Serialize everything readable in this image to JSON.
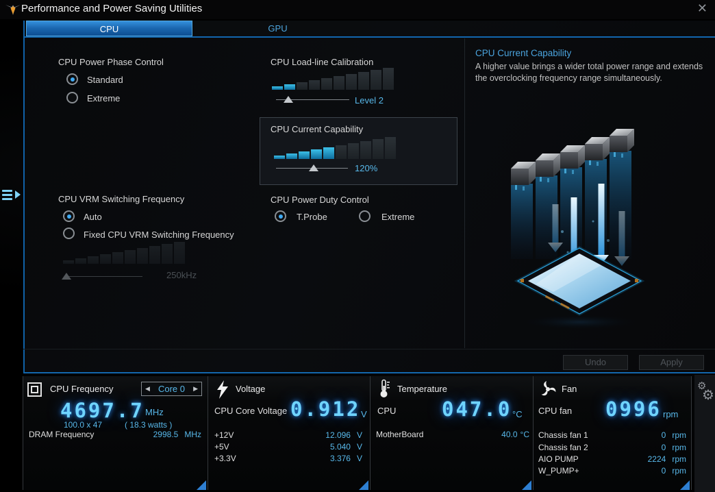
{
  "titlebar": {
    "title": "Performance and Power Saving Utilities",
    "close_icon": "✕"
  },
  "tabs": {
    "cpu": "CPU",
    "gpu": "GPU"
  },
  "controls": {
    "power_phase": {
      "label": "CPU Power Phase Control",
      "option1": "Standard",
      "option2": "Extreme",
      "selected": "Standard"
    },
    "loadline": {
      "label": "CPU Load-line Calibration",
      "value": "Level 2"
    },
    "current_capability": {
      "label": "CPU Current Capability",
      "value": "120%"
    },
    "vrm": {
      "label": "CPU VRM Switching Frequency",
      "option1": "Auto",
      "option2": "Fixed CPU VRM Switching Frequency",
      "value": "250kHz",
      "selected": "Auto"
    },
    "power_duty": {
      "label": "CPU Power Duty Control",
      "option1": "T.Probe",
      "option2": "Extreme",
      "selected": "T.Probe"
    }
  },
  "info": {
    "title": "CPU Current Capability",
    "description": "A higher value brings a wider total power range and extends the overclocking frequency range simultaneously."
  },
  "buttons": {
    "undo": "Undo",
    "apply": "Apply"
  },
  "status": {
    "cpu_freq": {
      "title": "CPU Frequency",
      "core": "Core 0",
      "prev_icon": "◀",
      "next_icon": "▶",
      "value": "4697.7",
      "unit": "MHz",
      "ratio": "100.0 x 47",
      "watts": "( 18.3 watts )",
      "dram_label": "DRAM Frequency",
      "dram_value": "2998.5",
      "dram_unit": "MHz"
    },
    "voltage": {
      "title": "Voltage",
      "main_label": "CPU Core Voltage",
      "main_value": "0.912",
      "main_unit": "V",
      "rows": [
        {
          "label": "+12V",
          "value": "12.096",
          "unit": "V"
        },
        {
          "label": "+5V",
          "value": "5.040",
          "unit": "V"
        },
        {
          "label": "+3.3V",
          "value": "3.376",
          "unit": "V"
        }
      ]
    },
    "temperature": {
      "title": "Temperature",
      "main_label": "CPU",
      "main_value": "047.0",
      "main_unit": "°C",
      "rows": [
        {
          "label": "MotherBoard",
          "value": "40.0",
          "unit": "°C"
        }
      ]
    },
    "fan": {
      "title": "Fan",
      "main_label": "CPU fan",
      "main_value": "0996",
      "main_unit": "rpm",
      "rows": [
        {
          "label": "Chassis fan 1",
          "value": "0",
          "unit": "rpm"
        },
        {
          "label": "Chassis fan 2",
          "value": "0",
          "unit": "rpm"
        },
        {
          "label": "AIO PUMP",
          "value": "2224",
          "unit": "rpm"
        },
        {
          "label": "W_PUMP+",
          "value": "0",
          "unit": "rpm"
        }
      ]
    },
    "settings_icon": "⚙"
  },
  "colors": {
    "accent_blue": "#1266ae",
    "value_cyan": "#58b8ea",
    "glow_cyan": "#6fd4ff",
    "tab_active": "#1a66ae",
    "disabled_text": "#4a4f54"
  }
}
